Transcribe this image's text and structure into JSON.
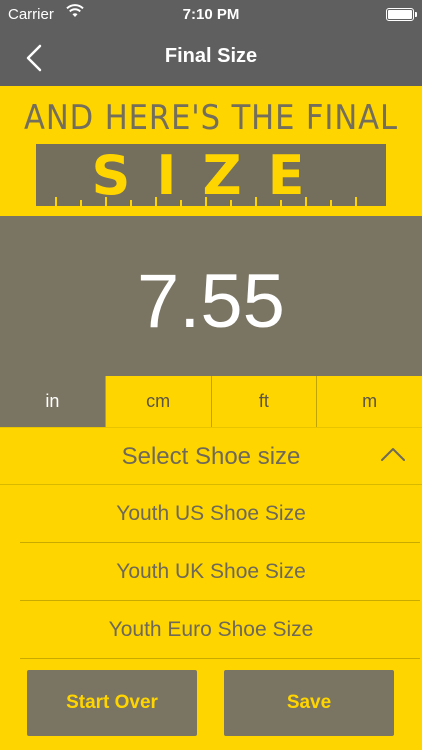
{
  "status_bar": {
    "carrier": "Carrier",
    "time": "7:10 PM"
  },
  "nav": {
    "title": "Final Size"
  },
  "hero": {
    "line1": "AND HERE'S THE FINAL",
    "line2": "SIZE"
  },
  "result": {
    "value": "7.55"
  },
  "units": [
    {
      "label": "in",
      "active": true
    },
    {
      "label": "cm",
      "active": false
    },
    {
      "label": "ft",
      "active": false
    },
    {
      "label": "m",
      "active": false
    }
  ],
  "select": {
    "label": "Select Shoe size",
    "options": [
      {
        "label": "Youth US Shoe Size"
      },
      {
        "label": "Youth UK Shoe Size"
      },
      {
        "label": "Youth Euro Shoe Size"
      }
    ]
  },
  "buttons": {
    "start_over": "Start Over",
    "save": "Save"
  },
  "colors": {
    "accent": "#FFD500",
    "panel": "#7A7462",
    "bar": "#5F5F5F"
  }
}
